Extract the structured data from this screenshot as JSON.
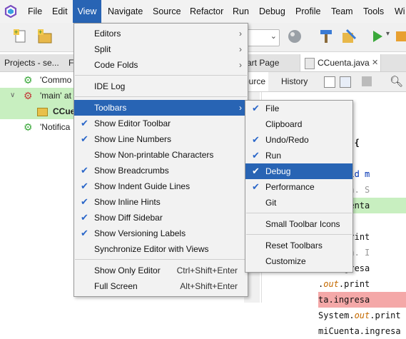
{
  "colors": {
    "accent": "#2864b4",
    "check": "#2a66c9",
    "green": "#4caf50",
    "highlight_green": "#c8efc0",
    "highlight_red": "#f4a8a8"
  },
  "menubar": {
    "items": [
      "File",
      "Edit",
      "View",
      "Navigate",
      "Source",
      "Refactor",
      "Run",
      "Debug",
      "Profile",
      "Team",
      "Tools",
      "Wi"
    ],
    "active": "View"
  },
  "projects": {
    "tabs": [
      "Projects - se...",
      "F"
    ],
    "tree": [
      {
        "label": "'Commo",
        "icon": "gear-icon"
      },
      {
        "label": "'main' at",
        "icon": "gear-error-icon"
      },
      {
        "label": "CCue",
        "icon": "folder-icon"
      },
      {
        "label": "'Notifica",
        "icon": "gear-icon"
      }
    ]
  },
  "editor": {
    "tabs": [
      "art Page",
      "CCuenta.java"
    ],
    "toolbar": {
      "source": "ource",
      "history": "History"
    },
    "code_lines": [
      {
        "text": "o.inv;",
        "style": "plain"
      },
      {
        "text": "",
        "style": "plain"
      },
      {
        "text": "Cuenta {",
        "style": "bold"
      },
      {
        "text": "",
        "style": "plain"
      },
      {
        "text": "tic void m",
        "style": "keyword"
      },
      {
        "text": "uracion. S",
        "style": "comment"
      },
      {
        "text": "a miCuenta",
        "style": "green"
      },
      {
        "text": "",
        "style": "plain"
      },
      {
        "text": ".out.print",
        "style": "out"
      },
      {
        "text": "uracion. I",
        "style": "comment"
      },
      {
        "text": "ta.ingresa",
        "style": "plain"
      },
      {
        "text": ".out.print",
        "style": "out"
      },
      {
        "text": "ta.ingresa",
        "style": "red"
      },
      {
        "text": "System.out.print",
        "style": "out"
      },
      {
        "text": "miCuenta.ingresa",
        "style": "plain"
      }
    ]
  },
  "view_menu": {
    "items": [
      {
        "label": "Editors",
        "submenu": true
      },
      {
        "label": "Split",
        "submenu": true
      },
      {
        "label": "Code Folds",
        "submenu": true
      },
      {
        "sep": true
      },
      {
        "label": "IDE Log"
      },
      {
        "sep": true
      },
      {
        "label": "Toolbars",
        "submenu": true,
        "selected": true
      },
      {
        "label": "Show Editor Toolbar",
        "checked": true
      },
      {
        "label": "Show Line Numbers",
        "checked": true
      },
      {
        "label": "Show Non-printable Characters"
      },
      {
        "label": "Show Breadcrumbs",
        "checked": true
      },
      {
        "label": "Show Indent Guide Lines",
        "checked": true
      },
      {
        "label": "Show Inline Hints",
        "checked": true
      },
      {
        "label": "Show Diff Sidebar",
        "checked": true
      },
      {
        "label": "Show Versioning Labels",
        "checked": true
      },
      {
        "label": "Synchronize Editor with Views"
      },
      {
        "sep": true
      },
      {
        "label": "Show Only Editor",
        "accel": "Ctrl+Shift+Enter"
      },
      {
        "label": "Full Screen",
        "accel": "Alt+Shift+Enter"
      }
    ]
  },
  "toolbars_submenu": {
    "items": [
      {
        "label": "File",
        "checked": true
      },
      {
        "label": "Clipboard"
      },
      {
        "label": "Undo/Redo",
        "checked": true
      },
      {
        "label": "Run",
        "checked": true
      },
      {
        "label": "Debug",
        "checked": true,
        "selected": true
      },
      {
        "label": "Performance",
        "checked": true
      },
      {
        "label": "Git"
      },
      {
        "sep": true
      },
      {
        "label": "Small Toolbar Icons"
      },
      {
        "sep": true
      },
      {
        "label": "Reset Toolbars"
      },
      {
        "label": "Customize"
      }
    ]
  }
}
